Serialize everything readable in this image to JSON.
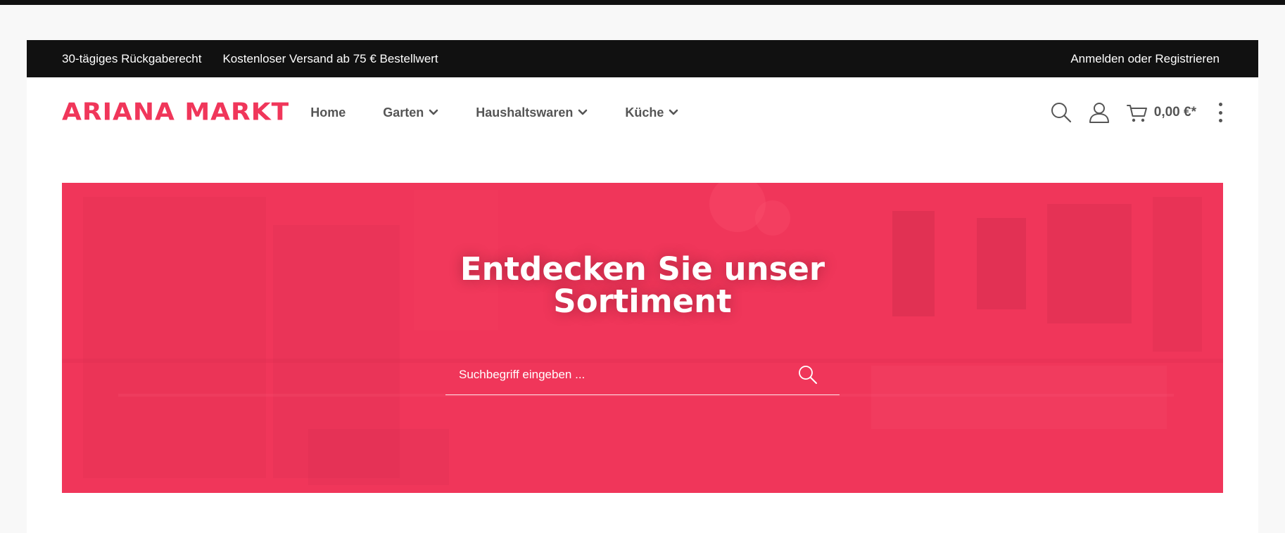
{
  "topbar": {
    "usps": [
      "30-tägiges Rückgaberecht",
      "Kostenloser Versand ab 75 € Bestellwert"
    ],
    "login_label": "Anmelden oder Registrieren"
  },
  "header": {
    "logo_text": "ARIANA MARKT",
    "nav": [
      {
        "label": "Home",
        "has_dropdown": false
      },
      {
        "label": "Garten",
        "has_dropdown": true
      },
      {
        "label": "Haushaltswaren",
        "has_dropdown": true
      },
      {
        "label": "Küche",
        "has_dropdown": true
      }
    ],
    "icons": [
      "search-icon",
      "account-icon",
      "cart-icon",
      "more-vertical-icon"
    ],
    "cart_total": "0,00 €*"
  },
  "hero": {
    "title_line1": "Entdecken Sie unser",
    "title_line2": "Sortiment",
    "search_placeholder": "Suchbegriff eingeben ..."
  },
  "colors": {
    "accent": "#f0365a",
    "topbar_bg": "#111111",
    "nav_text": "#555555",
    "page_bg": "#f8f8f8"
  }
}
